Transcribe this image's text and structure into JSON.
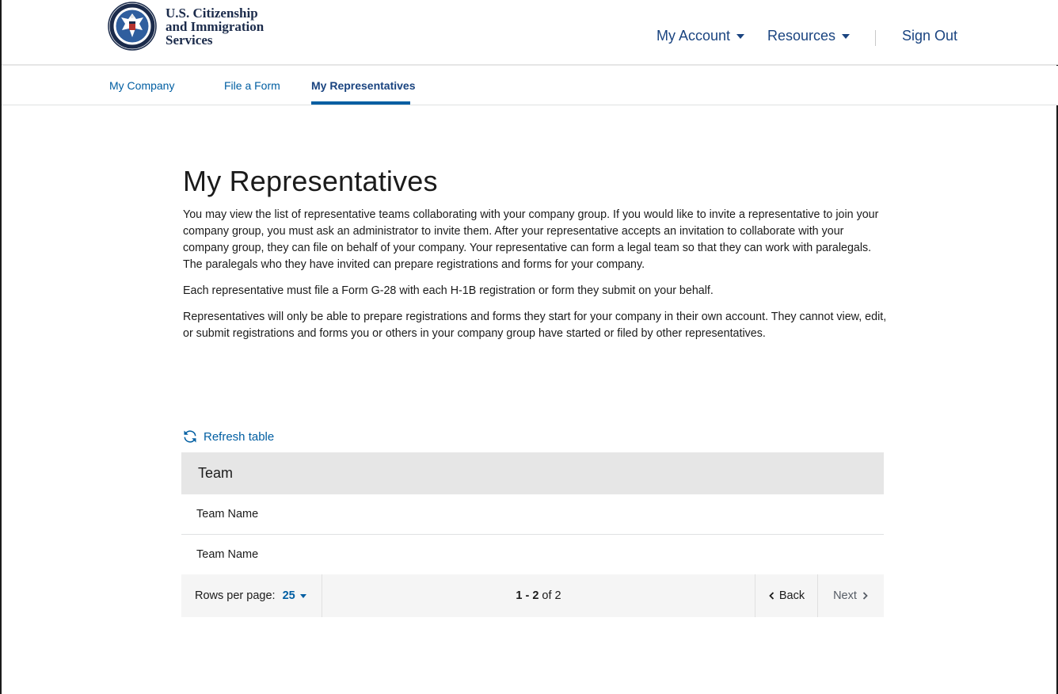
{
  "header": {
    "agency_line1": "U.S. Citizenship",
    "agency_line2": "and Immigration",
    "agency_line3": "Services",
    "nav": {
      "my_account": "My Account",
      "resources": "Resources",
      "sign_out": "Sign Out"
    }
  },
  "subnav": {
    "tabs": [
      {
        "label": "My Company"
      },
      {
        "label": "File a Form"
      },
      {
        "label": "My Representatives"
      }
    ],
    "active_tab": "My Representatives"
  },
  "main": {
    "title": "My Representatives",
    "paragraphs": [
      "You may view the list of representative teams collaborating with your company group. If you would like to invite a representative to join your company group, you must ask an administrator to invite them. After your representative accepts an invitation to collaborate with your company group, they can file on behalf of your company. Your representative can form a legal team so that they can work with paralegals. The paralegals who they have invited can prepare registrations and forms for your company.",
      "Each representative must file a Form G-28 with each H-1B registration or form they submit on your behalf.",
      "Representatives will only be able to prepare registrations and forms they start for your company in their own account. They cannot view, edit, or submit registrations and forms you or others in your company group have started or filed by other representatives."
    ],
    "refresh_label": "Refresh table"
  },
  "table": {
    "header": "Team",
    "rows": [
      "Team Name",
      "Team Name"
    ]
  },
  "pagination": {
    "rows_per_page_label": "Rows per page:",
    "rows_per_page_value": "25",
    "range": "1 - 2",
    "of_label": "of",
    "total": "2",
    "back_label": "Back",
    "next_label": "Next"
  },
  "colors": {
    "link": "#005ea2",
    "nav_text": "#1a4480",
    "table_header_bg": "#e6e6e6",
    "pager_bg": "#f5f5f5"
  },
  "icons": {
    "seal": "dhs-seal-icon",
    "refresh": "refresh-icon",
    "chevron_left": "chevron-left-icon",
    "chevron_right": "chevron-right-icon",
    "caret_down": "caret-down-icon"
  }
}
